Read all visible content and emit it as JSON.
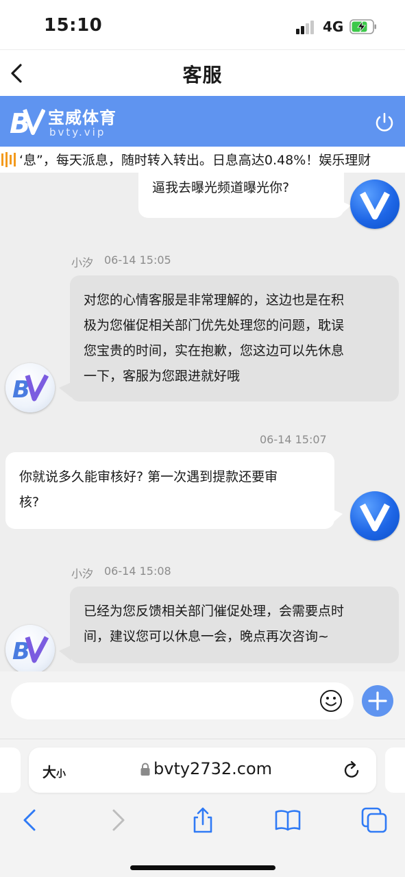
{
  "status_bar": {
    "time": "15:10",
    "network": "4G",
    "battery": "charging"
  },
  "nav": {
    "title": "客服"
  },
  "banner": {
    "brand_name": "宝威体育",
    "brand_sub": "bvty.vip",
    "accent_color": "#5f94f0"
  },
  "marquee": {
    "text": "‘息”，每天派息，随时转入转出。日息高达0.48%！娱乐理财"
  },
  "chat": {
    "messages": [
      {
        "from": "user",
        "lines": [
          "逼我去曝光频道曝光你?"
        ]
      },
      {
        "from": "agent",
        "sender": "小汐",
        "time": "06-14 15:05",
        "lines": [
          "对您的心情客服是非常理解的，这边也是在积",
          "极为您催促相关部门优先处理您的问题，耽误",
          "您宝贵的时间，实在抱歉，您这边可以先休息",
          "一下，客服为您跟进就好哦"
        ]
      },
      {
        "from": "user",
        "time": "06-14 15:07",
        "lines": [
          "你就说多久能审核好? 第一次遇到提款还要审",
          "核?"
        ]
      },
      {
        "from": "agent",
        "sender": "小汐",
        "time": "06-14 15:08",
        "lines": [
          "已经为您反馈相关部门催促处理，会需要点时",
          "间，建议您可以休息一会，晚点再次咨询~"
        ]
      }
    ]
  },
  "input": {
    "placeholder": ""
  },
  "safari": {
    "text_size_big": "大",
    "text_size_small": "小",
    "url": "bvty2732.com"
  }
}
